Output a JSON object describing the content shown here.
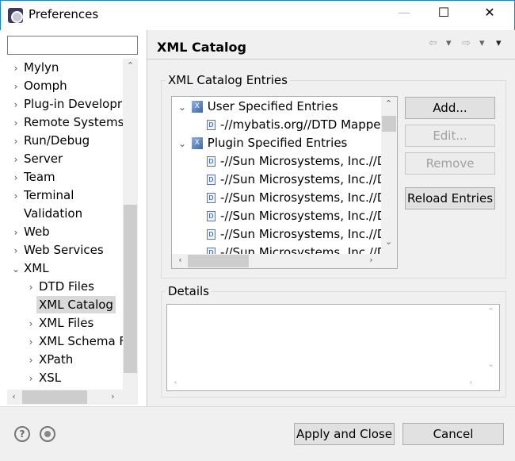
{
  "window": {
    "title": "Preferences",
    "minimize": "—",
    "maximize": "☐",
    "close": "✕"
  },
  "search": {
    "value": "",
    "placeholder": ""
  },
  "sidebar": {
    "items": [
      {
        "label": "Mylyn",
        "level": 0,
        "arrow": "›"
      },
      {
        "label": "Oomph",
        "level": 0,
        "arrow": "›"
      },
      {
        "label": "Plug-in Developr",
        "level": 0,
        "arrow": "›"
      },
      {
        "label": "Remote Systems",
        "level": 0,
        "arrow": "›"
      },
      {
        "label": "Run/Debug",
        "level": 0,
        "arrow": "›"
      },
      {
        "label": "Server",
        "level": 0,
        "arrow": "›"
      },
      {
        "label": "Team",
        "level": 0,
        "arrow": "›"
      },
      {
        "label": "Terminal",
        "level": 0,
        "arrow": "›"
      },
      {
        "label": "Validation",
        "level": 0,
        "arrow": ""
      },
      {
        "label": "Web",
        "level": 0,
        "arrow": "›"
      },
      {
        "label": "Web Services",
        "level": 0,
        "arrow": "›"
      },
      {
        "label": "XML",
        "level": 0,
        "arrow": "⌄"
      },
      {
        "label": "DTD Files",
        "level": 1,
        "arrow": "›"
      },
      {
        "label": "XML Catalog",
        "level": 1,
        "arrow": "",
        "selected": true
      },
      {
        "label": "XML Files",
        "level": 1,
        "arrow": "›"
      },
      {
        "label": "XML Schema F",
        "level": 1,
        "arrow": "›"
      },
      {
        "label": "XPath",
        "level": 1,
        "arrow": "›"
      },
      {
        "label": "XSL",
        "level": 1,
        "arrow": "›"
      }
    ]
  },
  "page": {
    "title": "XML Catalog",
    "nav": {
      "back": "⇦",
      "forward": "⇨",
      "menu": "▾"
    }
  },
  "entries": {
    "label": "XML Catalog Entries",
    "rows": [
      {
        "label": "User Specified Entries",
        "type": "group"
      },
      {
        "label": "-//mybatis.org//DTD Mapper",
        "type": "entry"
      },
      {
        "label": "Plugin Specified Entries",
        "type": "group"
      },
      {
        "label": "-//Sun Microsystems, Inc.//DTD",
        "type": "entry"
      },
      {
        "label": "-//Sun Microsystems, Inc.//DTD",
        "type": "entry"
      },
      {
        "label": "-//Sun Microsystems, Inc.//DTD",
        "type": "entry"
      },
      {
        "label": "-//Sun Microsystems, Inc.//DTD",
        "type": "entry"
      },
      {
        "label": "-//Sun Microsystems, Inc.//DTD",
        "type": "entry"
      },
      {
        "label": "-//Sun Microsystems, Inc.//DTD",
        "type": "entry"
      }
    ],
    "buttons": {
      "add": "Add...",
      "edit": "Edit...",
      "remove": "Remove",
      "reload": "Reload Entries"
    }
  },
  "details": {
    "label": "Details",
    "value": ""
  },
  "footer": {
    "help": "?",
    "apply_close": "Apply and Close",
    "cancel": "Cancel"
  },
  "colors": {
    "selection": "#d9d9d9",
    "window_border": "#1883d7",
    "background": "#f0f0f0"
  }
}
